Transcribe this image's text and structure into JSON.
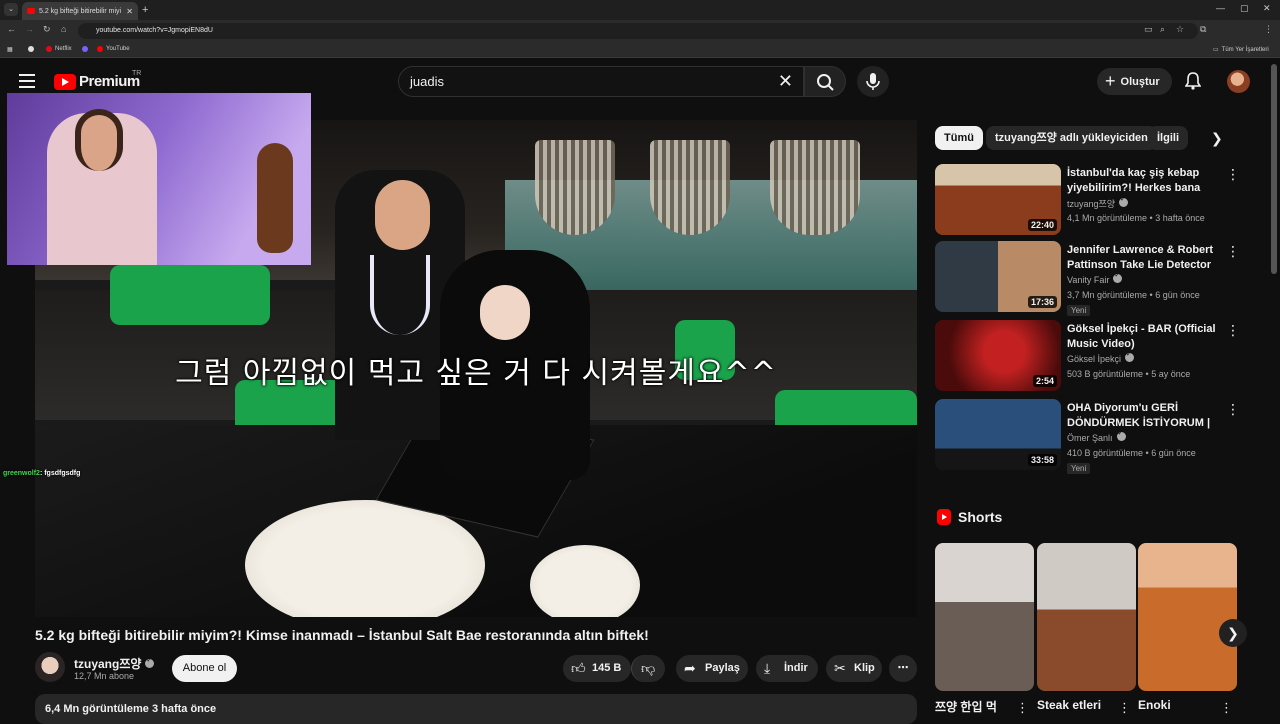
{
  "browser": {
    "tab_title": "5.2 kg bifteği bitirebilir miyi",
    "tab_close": "✕",
    "new_tab": "+",
    "url": "youtube.com/watch?v=JgmopiEN8dU",
    "bookmarks": [
      "Netflix",
      "YouTube"
    ],
    "all_bookmarks": "Tüm Yer İşaretleri",
    "window_controls": [
      "—",
      "▢",
      "✕"
    ]
  },
  "header": {
    "logo_text": "Premium",
    "logo_region": "TR",
    "search_value": "juadis",
    "create_label": "Oluştur",
    "colors": {
      "brand": "#ff0000",
      "bg": "#0f0f0f"
    }
  },
  "video": {
    "subtitle": "그럼 아낌없이 먹고 싶은 거 다 시켜볼게요^^",
    "chat": {
      "user": "greenwolf2",
      "message": ": fgsdfgsdfg"
    }
  },
  "meta": {
    "title": "5.2 kg bifteği bitirebilir miyim?! Kimse inanmadı – İstanbul Salt Bae restoranında altın biftek!",
    "channel": "tzuyang쯔양",
    "subscribers": "12,7 Mn abone",
    "subscribe_label": "Abone ol",
    "likes": "145 B",
    "share_label": "Paylaş",
    "download_label": "İndir",
    "clip_label": "Klip",
    "views_time": "6,4 Mn görüntüleme  3 hafta önce"
  },
  "rail": {
    "chips": [
      "Tümü",
      "tzuyang쯔양 adlı yükleyiciden",
      "İlgili"
    ],
    "recommendations": [
      {
        "title": "İstanbul'da kaç şiş kebap yiyebilirim?! Herkes bana deli ...",
        "channel": "tzuyang쯔양",
        "meta": "4,1 Mn görüntüleme • 3 hafta önce",
        "duration": "22:40",
        "badge": ""
      },
      {
        "title": "Jennifer Lawrence & Robert Pattinson Take Lie Detector ...",
        "channel": "Vanity Fair",
        "meta": "3,7 Mn görüntüleme • 6 gün önce",
        "duration": "17:36",
        "badge": "Yeni"
      },
      {
        "title": "Göksel İpekçi - BAR (Official Music Video)",
        "channel": "Göksel İpekçi",
        "meta": "503 B görüntüleme • 5 ay önce",
        "duration": "2:54",
        "badge": ""
      },
      {
        "title": "OHA Diyorum'u GERİ DÖNDÜRMEK İSTİYORUM | ...",
        "channel": "Ömer Şanlı",
        "meta": "410 B görüntüleme • 6 gün önce",
        "duration": "33:58",
        "badge": "Yeni"
      }
    ],
    "shorts_heading": "Shorts",
    "shorts": [
      "쯔양 한입 먹",
      "Steak etleri",
      "Enoki"
    ]
  }
}
